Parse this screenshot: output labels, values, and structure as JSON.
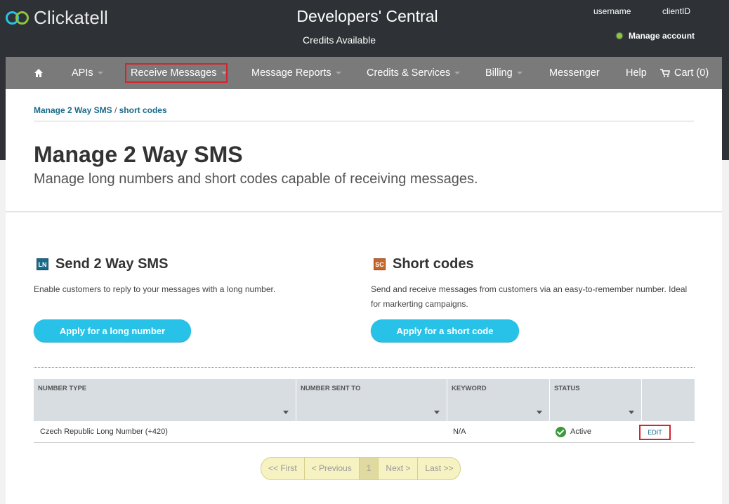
{
  "header": {
    "logo_text": "Clickatell",
    "title": "Developers' Central",
    "credits": "Credits Available",
    "username": "username",
    "client_id": "clientID",
    "manage_account": "Manage account"
  },
  "nav": {
    "apis": "APIs",
    "receive_messages": "Receive Messages",
    "message_reports": "Message Reports",
    "credits_services": "Credits & Services",
    "billing": "Billing",
    "messenger": "Messenger",
    "help": "Help",
    "cart": "Cart (0)"
  },
  "breadcrumb": {
    "part1": "Manage 2 Way SMS",
    "sep": "/",
    "part2": "short codes"
  },
  "page": {
    "title": "Manage 2 Way SMS",
    "subtitle": "Manage long numbers and short codes capable of receiving messages."
  },
  "long_number": {
    "badge": "LN",
    "heading": "Send 2 Way SMS",
    "description": "Enable customers to reply to your messages with a long number.",
    "button": "Apply for a long number"
  },
  "short_code": {
    "badge": "SC",
    "heading": "Short codes",
    "description_line1": "Send and receive messages from customers via an easy-to-remember number. Ideal",
    "description_line2": "for markerting campaigns.",
    "button": "Apply for a short code"
  },
  "table": {
    "columns": [
      "NUMBER TYPE",
      "NUMBER SENT TO",
      "KEYWORD",
      "STATUS"
    ],
    "rows": [
      {
        "number_type": "Czech Republic Long Number (+420)",
        "number_sent_to": "",
        "keyword": "N/A",
        "status": "Active",
        "action": "EDIT"
      }
    ]
  },
  "pagination": {
    "first": "<< First",
    "previous": "< Previous",
    "current": "1",
    "next": "Next >",
    "last": "Last >>"
  }
}
